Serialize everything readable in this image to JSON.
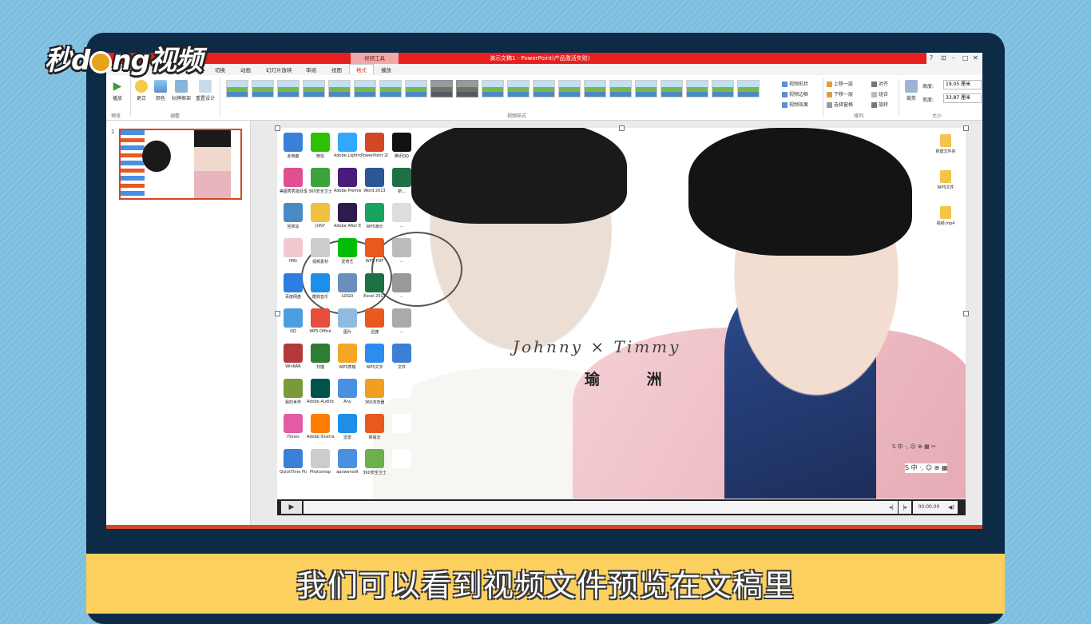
{
  "watermark": {
    "logo_text_a": "秒",
    "logo_text_b": "ng视频",
    "logo_text_d": "d"
  },
  "window": {
    "title": "演示文稿1 - PowerPoint(产品激活失败)",
    "context_group": "视频工具",
    "controls": [
      "?",
      "⊡",
      "–",
      "□",
      "✕"
    ]
  },
  "tabs": [
    "设计",
    "切换",
    "动画",
    "幻灯片放映",
    "审阅",
    "视图",
    "格式",
    "播放"
  ],
  "active_tab_index": 6,
  "ribbon": {
    "preview": {
      "play": "播放",
      "group": "预览"
    },
    "adjust": {
      "corrections": "更正",
      "color": "颜色",
      "poster_frame": "标牌框架",
      "reset": "重置设计",
      "group": "调整"
    },
    "styles_group": "视频样式",
    "style_count": 21,
    "video_shape": "视频形状",
    "video_border": "视频边框",
    "video_effects": "视频效果",
    "arrange": {
      "bring_forward": "上移一层",
      "send_backward": "下移一层",
      "selection_pane": "选择窗格",
      "align": "对齐",
      "group": "组合",
      "rotate": "旋转",
      "group_label": "排列"
    },
    "size": {
      "crop": "裁剪",
      "height_label": "高度:",
      "height": "19.05 厘米",
      "width_label": "宽度:",
      "width": "33.87 厘米",
      "group_label": "大小"
    }
  },
  "thumbnails": {
    "slide_number": "1"
  },
  "slide": {
    "title_en": "Johnny × Timmy",
    "title_zh": "瑜 洲",
    "desktop_icons": [
      {
        "label": "此电脑",
        "color": "#3b7fd6"
      },
      {
        "label": "微信",
        "color": "#2dc100"
      },
      {
        "label": "Adobe Lightroo...",
        "color": "#31a8ff"
      },
      {
        "label": "PowerPoint 2013",
        "color": "#d24726"
      },
      {
        "label": "腾讯QQ",
        "color": "#111111"
      },
      {
        "label": "美图秀秀批处理",
        "color": "#e04f8f"
      },
      {
        "label": "360安全卫士",
        "color": "#3ca33c"
      },
      {
        "label": "Adobe Premiere P...",
        "color": "#4a1c7a"
      },
      {
        "label": "Word 2013",
        "color": "#2b5797"
      },
      {
        "label": "新...",
        "color": "#1e7145"
      },
      {
        "label": "回收站",
        "color": "#4a8ac2"
      },
      {
        "label": "JUN7",
        "color": "#f0c040"
      },
      {
        "label": "Adobe After Effects CC",
        "color": "#2d1b4e"
      },
      {
        "label": "WPS演示",
        "color": "#1aa260"
      },
      {
        "label": "...",
        "color": "#dddddd"
      },
      {
        "label": "IMG",
        "color": "#f3c9d0"
      },
      {
        "label": "视频素材",
        "color": "#cccccc"
      },
      {
        "label": "爱奇艺",
        "color": "#00be06"
      },
      {
        "label": "WPS PDF",
        "color": "#e8581f"
      },
      {
        "label": "...",
        "color": "#bbbbbb"
      },
      {
        "label": "百度网盘",
        "color": "#2e7de1"
      },
      {
        "label": "酷狗音乐",
        "color": "#1e8fe8"
      },
      {
        "label": "LOGO",
        "color": "#6a8fbf"
      },
      {
        "label": "Excel 2013",
        "color": "#1e7145"
      },
      {
        "label": "...",
        "color": "#999999"
      },
      {
        "label": "QQ",
        "color": "#4a9fe0"
      },
      {
        "label": "WPS Office",
        "color": "#e74c3c"
      },
      {
        "label": "图片",
        "color": "#8fbbe0"
      },
      {
        "label": "迅捷",
        "color": "#e8581f"
      },
      {
        "label": "...",
        "color": "#aaaaaa"
      },
      {
        "label": "WinRAR",
        "color": "#b23a3a"
      },
      {
        "label": "扫描",
        "color": "#2e7d32"
      },
      {
        "label": "WPS表格",
        "color": "#f5a623"
      },
      {
        "label": "WPS文字",
        "color": "#2d8cf0"
      },
      {
        "label": "文件",
        "color": "#3b7fd6"
      },
      {
        "label": "我的世界",
        "color": "#7a9a3a"
      },
      {
        "label": "Adobe Audition",
        "color": "#00534a"
      },
      {
        "label": "Any",
        "color": "#4a90e2"
      },
      {
        "label": "360浏览器",
        "color": "#f0a020"
      },
      {
        "label": "",
        "color": "#ffffff"
      },
      {
        "label": "iTunes",
        "color": "#e35ba3"
      },
      {
        "label": "Adobe Illustrator",
        "color": "#ff7c00"
      },
      {
        "label": "迅雷",
        "color": "#1e8fe8"
      },
      {
        "label": "网易云",
        "color": "#e8581f"
      },
      {
        "label": "",
        "color": "#ffffff"
      },
      {
        "label": "QuickTime Player",
        "color": "#3b7fd6"
      },
      {
        "label": "Photoshop",
        "color": "#cccccc"
      },
      {
        "label": "apowersoft",
        "color": "#4a90e2"
      },
      {
        "label": "360安全卫士",
        "color": "#6ab04c"
      },
      {
        "label": "",
        "color": "#ffffff"
      }
    ],
    "right_icons": [
      "新建文件夹",
      "WPS文件",
      "视频.mp4"
    ],
    "ime_bar_1": "S 中 ·, ☺ ⊕ ▦ ✂",
    "ime_bar_2": "S 中 ·, ☺ ⊕ ▦"
  },
  "player": {
    "play": "▶",
    "back": "◂|",
    "forward": "|▸",
    "time": "00:00.00",
    "volume": "◀)"
  },
  "subtitle": "我们可以看到视频文件预览在文稿里"
}
